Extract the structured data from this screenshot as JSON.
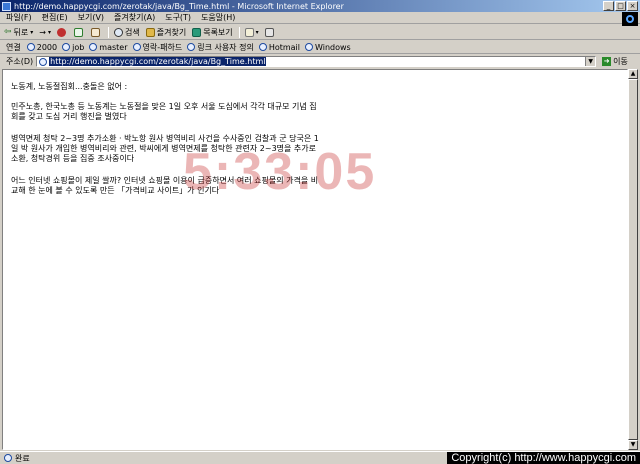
{
  "window": {
    "title": "http://demo.happycgi.com/zerotak/java/Bg_Time.html - Microsoft Internet Explorer",
    "buttons": {
      "minimize": "_",
      "maximize": "□",
      "close": "×"
    }
  },
  "menu": [
    "파일(F)",
    "편집(E)",
    "보기(V)",
    "즐겨찾기(A)",
    "도구(T)",
    "도움말(H)"
  ],
  "toolbar": {
    "back": "뒤로",
    "forward_symbol": "→",
    "search": "검색",
    "favorites": "즐겨찾기",
    "history": "목록보기"
  },
  "links": {
    "label": "연결",
    "items": [
      "2000",
      "job",
      "master",
      "영락-패하드",
      "링크 사용자 정의",
      "Hotmail",
      "Windows"
    ]
  },
  "address": {
    "label": "주소(D)",
    "url": "http://demo.happycgi.com/zerotak/java/Bg_Time.html",
    "go": "이동"
  },
  "content": {
    "paragraphs": [
      "노동계, 노동절집회...충돌은 없어 :",
      "민주노총, 한국노총 등 노동계는 노동절을 맞은 1일 오후 서울 도심에서 각각 대규모 기념 집회를 갖고 도심 거리 행진을 벌였다",
      "병역면제 청탁 2~3명 추가소환 · 박노항 원사 병역비리 사건을 수사중인 검찰과 군 당국은 1일 박 원사가 개입한 병역비리와 관련, 박씨에게 병역면제를 청탁한 관련자 2~3명을 추가로 소환, 청탁경위 등을 집중 조사중이다",
      "어느 인터넷 쇼핑몰이 제일 쌀까? 인터넷 쇼핑몰 이용이 급증하면서 여러 쇼핑몰의 가격을 비교해 한 눈에 볼 수 있도록 만든 「가격비교 사이트」가 인기다"
    ],
    "clock": "5:33:05"
  },
  "status": {
    "text": "완료",
    "copyright": "Copyright(c) http://www.happycgi.com"
  }
}
